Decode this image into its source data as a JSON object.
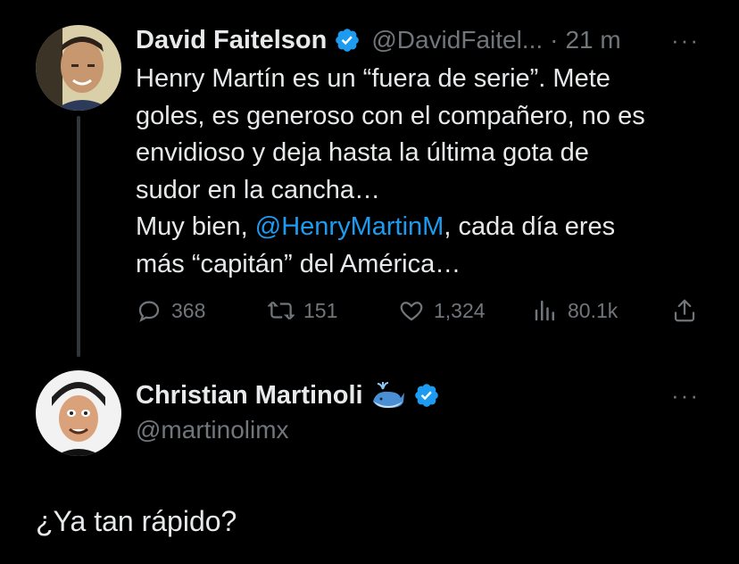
{
  "tweet1": {
    "name": "David Faitelson",
    "handle": "@DavidFaitel...",
    "separator": "·",
    "time": "21 m",
    "lines": [
      "Henry Martín es un “fuera de serie”. Mete",
      "goles, es generoso con el compañero, no es",
      "envidioso y deja hasta la última gota de",
      "sudor en la cancha…"
    ],
    "line5_prefix": "Muy bien, ",
    "line5_mention": "@HenryMartinM",
    "line5_suffix": ", cada día eres",
    "line6": "más “capitán” del América…",
    "actions": {
      "replies": "368",
      "retweets": "151",
      "likes": "1,324",
      "views": "80.1k"
    },
    "more": "···"
  },
  "tweet2": {
    "name": "Christian Martinoli",
    "handle": "@martinolimx",
    "more": "···",
    "text": "¿Ya tan rápido?"
  },
  "colors": {
    "background": "#000000",
    "text": "#e7e9ea",
    "muted": "#71767b",
    "accent": "#1d9bf0",
    "thread_line": "#333639"
  },
  "icons": [
    "verified-badge-icon",
    "whale-emoji-icon",
    "reply-icon",
    "retweet-icon",
    "like-icon",
    "views-icon",
    "share-icon",
    "more-icon"
  ]
}
